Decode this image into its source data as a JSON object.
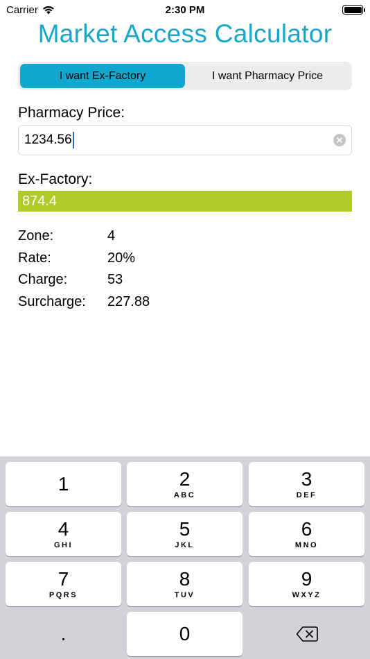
{
  "status_bar": {
    "carrier": "Carrier",
    "time": "2:30 PM"
  },
  "app": {
    "title": "Market Access Calculator"
  },
  "segmented": {
    "options": [
      {
        "label": "I want Ex-Factory",
        "selected": true
      },
      {
        "label": "I want Pharmacy Price",
        "selected": false
      }
    ]
  },
  "input": {
    "label": "Pharmacy Price:",
    "value": "1234.56"
  },
  "result": {
    "label": "Ex-Factory:",
    "value": "874.4"
  },
  "details": [
    {
      "key": "Zone:",
      "value": "4"
    },
    {
      "key": "Rate:",
      "value": "20%"
    },
    {
      "key": "Charge:",
      "value": "53"
    },
    {
      "key": "Surcharge:",
      "value": "227.88"
    }
  ],
  "keyboard": {
    "keys": [
      {
        "num": "1",
        "letters": ""
      },
      {
        "num": "2",
        "letters": "ABC"
      },
      {
        "num": "3",
        "letters": "DEF"
      },
      {
        "num": "4",
        "letters": "GHI"
      },
      {
        "num": "5",
        "letters": "JKL"
      },
      {
        "num": "6",
        "letters": "MNO"
      },
      {
        "num": "7",
        "letters": "PQRS"
      },
      {
        "num": "8",
        "letters": "TUV"
      },
      {
        "num": "9",
        "letters": "WXYZ"
      }
    ],
    "decimal": ".",
    "zero": "0"
  },
  "icons": {
    "wifi": "wifi-icon",
    "battery": "battery-icon",
    "clear": "clear-circle-icon",
    "delete": "backspace-icon"
  },
  "colors": {
    "accent": "#1aa6c9",
    "segment_active": "#10a7cf",
    "result_bg": "#aecb2a",
    "keyboard_bg": "#d1d3d9"
  }
}
